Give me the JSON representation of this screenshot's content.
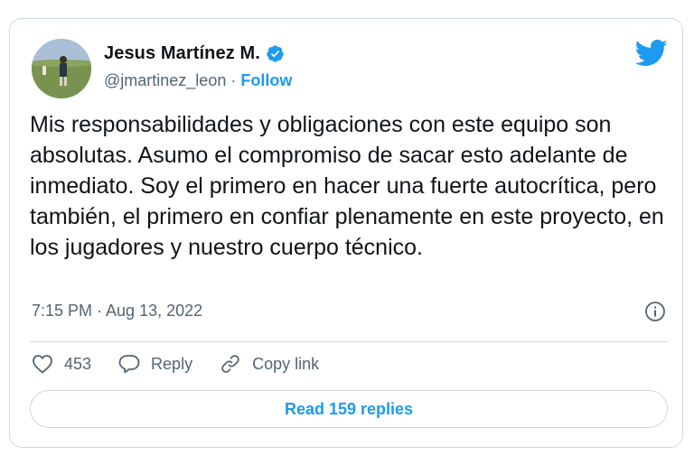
{
  "author": {
    "name": "Jesus Martínez M.",
    "handle": "@jmartinez_leon",
    "separator": "·",
    "follow_label": "Follow",
    "verified": true
  },
  "tweet": {
    "text": "Mis responsabilidades y obligaciones con este equipo son absolutas. Asumo el compromiso de sacar esto adelante de inmediato. Soy el primero en hacer una fuerte autocrítica, pero también, el primero en confiar plenamente en este proyecto, en los jugadores y nuestro cuerpo técnico.",
    "timestamp": "7:15 PM · Aug 13, 2022"
  },
  "actions": {
    "like_count": "453",
    "reply_label": "Reply",
    "copy_link_label": "Copy link"
  },
  "read_replies_label": "Read 159 replies",
  "icons": {
    "brand": "twitter-bird-icon",
    "verified": "verified-badge-icon",
    "info": "info-icon",
    "like": "heart-icon",
    "reply": "speech-bubble-icon",
    "copy_link": "link-icon"
  },
  "colors": {
    "accent": "#1d9bf0",
    "text": "#0f1419",
    "secondary_text": "#536471",
    "border": "#cfd9de"
  }
}
